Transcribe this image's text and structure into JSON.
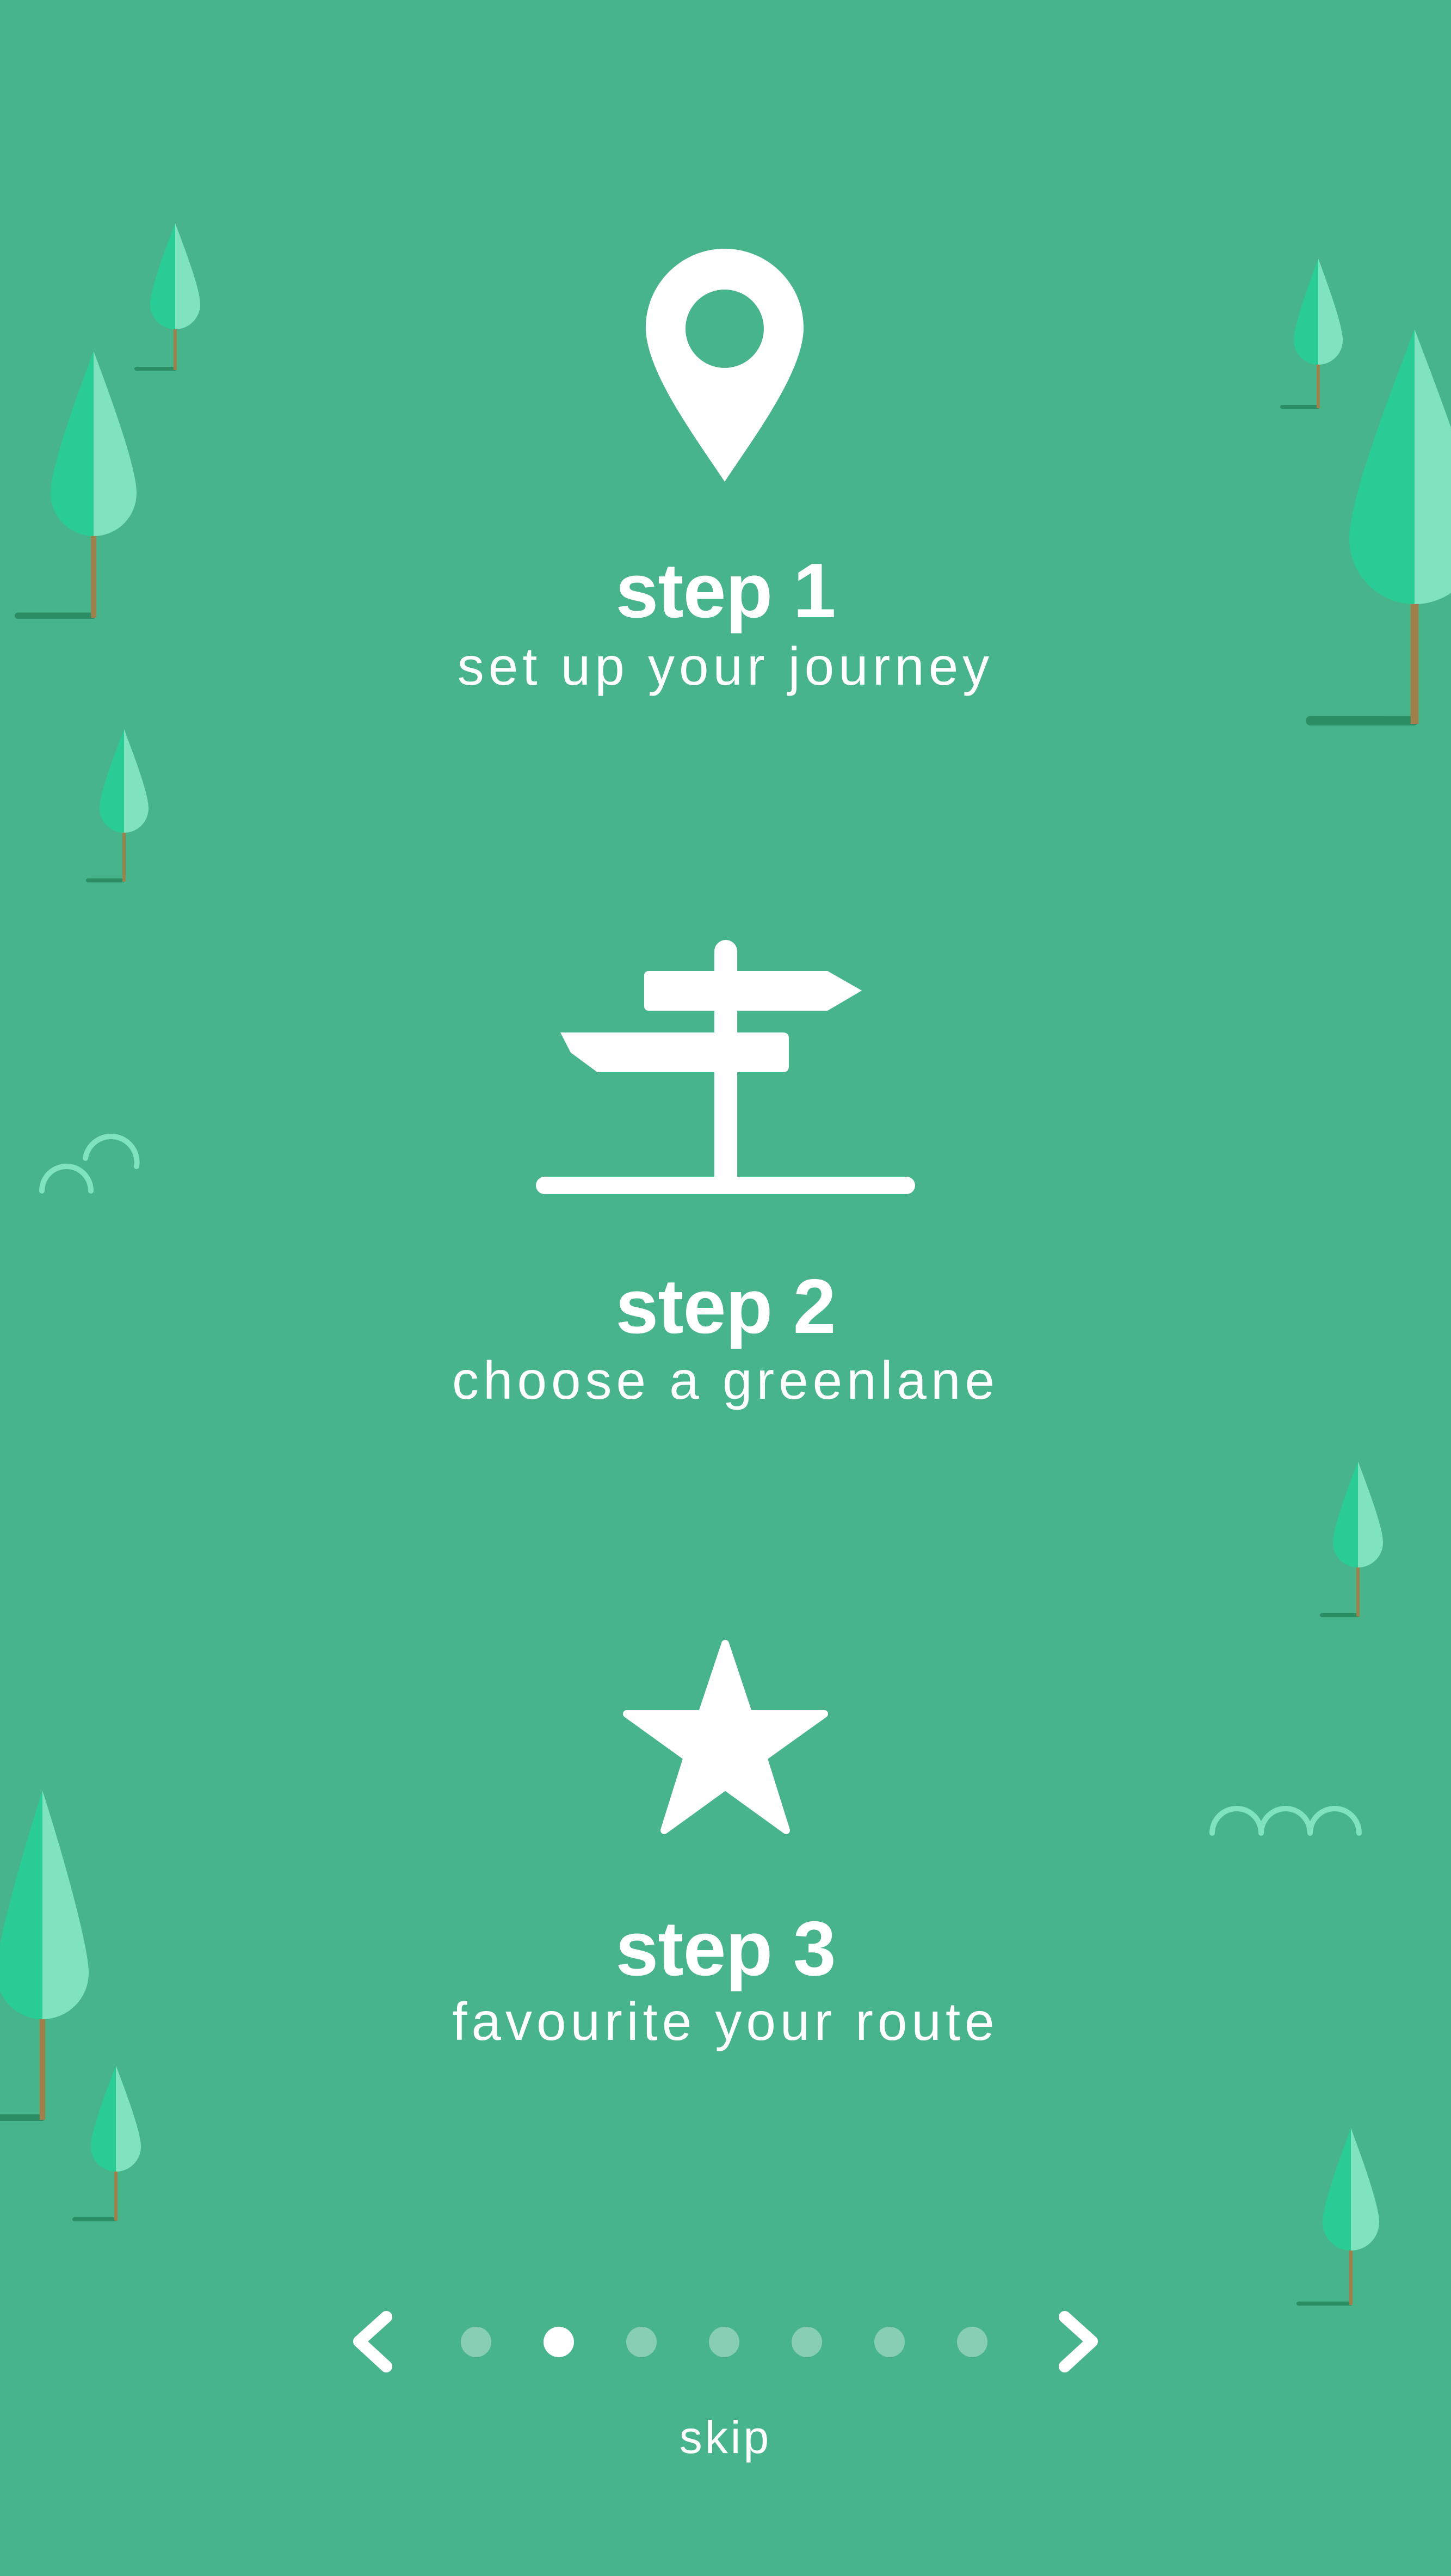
{
  "theme": {
    "background": "#48b48c",
    "foreground": "#ffffff",
    "tree_light": "#7fe3bf",
    "tree_dark": "#29cc95",
    "trunk": "#a0804a",
    "ground": "#2b8d63"
  },
  "steps": [
    {
      "title": "step 1",
      "subtitle": "set up your journey",
      "icon": "location-pin-icon"
    },
    {
      "title": "step 2",
      "subtitle": "choose a greenlane",
      "icon": "signpost-icon"
    },
    {
      "title": "step 3",
      "subtitle": "favourite your route",
      "icon": "star-icon"
    }
  ],
  "pagination": {
    "total": 7,
    "active_index": 1,
    "prev_icon": "chevron-left-icon",
    "next_icon": "chevron-right-icon"
  },
  "skip_label": "skip"
}
